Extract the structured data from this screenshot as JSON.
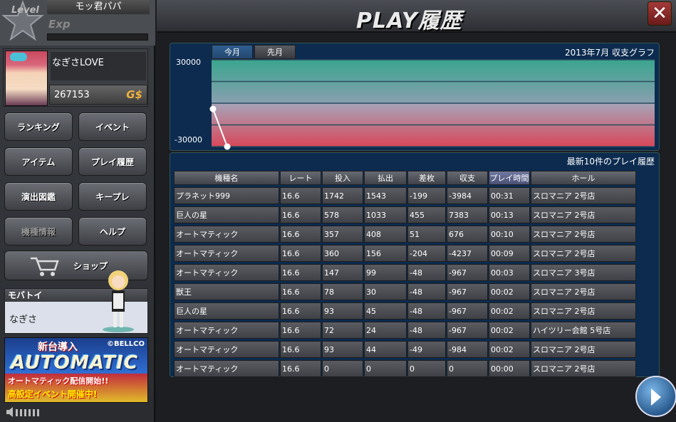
{
  "sidebar": {
    "level_label": "Level",
    "player_name": "モッ君パパ",
    "exp_label": "Exp",
    "profile_name": "なぎさLOVE",
    "coins": "267153",
    "coin_unit": "G$",
    "menu": [
      {
        "label": "ランキング"
      },
      {
        "label": "イベント"
      },
      {
        "label": "アイテム"
      },
      {
        "label": "プレイ履歴"
      },
      {
        "label": "演出図鑑"
      },
      {
        "label": "キープレ"
      },
      {
        "label": "機種情報"
      },
      {
        "label": "ヘルプ"
      }
    ],
    "shop_label": "ショップ",
    "mobatoy_title": "モバトイ",
    "mobatoy_name": "なぎさ",
    "banner": {
      "new": "新台導入",
      "copyright": "©BELLCO",
      "logo": "AUTOMATIC",
      "line2": "オートマティック配信開始!!",
      "line3": "高設定イベント開催中!"
    }
  },
  "header": {
    "title": "PLAY履歴",
    "close": "✕"
  },
  "graph": {
    "tabs": [
      {
        "label": "今月"
      },
      {
        "label": "先月"
      }
    ],
    "title": "2013年7月 収支グラフ"
  },
  "chart_data": {
    "type": "line",
    "title": "2013年7月 収支グラフ",
    "ylim": [
      -30000,
      30000
    ],
    "yticks": [
      "30000",
      "-30000"
    ],
    "x": [
      1,
      2
    ],
    "values": [
      -3984,
      -30000
    ],
    "colors": {
      "positive": "#3aa58e",
      "negative": "#d8485a",
      "line": "#ffffff"
    }
  },
  "history": {
    "title": "最新10件のプレイ履歴",
    "columns": [
      "機種名",
      "レート",
      "投入",
      "払出",
      "差枚",
      "収支",
      "プレイ時間",
      "ホール"
    ],
    "rows": [
      [
        "プラネット999",
        "16.6",
        "1742",
        "1543",
        "-199",
        "-3984",
        "00:31",
        "スロマニア 2号店"
      ],
      [
        "巨人の星",
        "16.6",
        "578",
        "1033",
        "455",
        "7383",
        "00:13",
        "スロマニア 2号店"
      ],
      [
        "オートマティック",
        "16.6",
        "357",
        "408",
        "51",
        "676",
        "00:10",
        "スロマニア 2号店"
      ],
      [
        "オートマティック",
        "16.6",
        "360",
        "156",
        "-204",
        "-4237",
        "00:09",
        "スロマニア 2号店"
      ],
      [
        "オートマティック",
        "16.6",
        "147",
        "99",
        "-48",
        "-967",
        "00:03",
        "スロマニア 3号店"
      ],
      [
        "獣王",
        "16.6",
        "78",
        "30",
        "-48",
        "-967",
        "00:02",
        "スロマニア 2号店"
      ],
      [
        "巨人の星",
        "16.6",
        "93",
        "45",
        "-48",
        "-967",
        "00:02",
        "スロマニア 2号店"
      ],
      [
        "オートマティック",
        "16.6",
        "72",
        "24",
        "-48",
        "-967",
        "00:02",
        "ハイツリー会館 5号店"
      ],
      [
        "オートマティック",
        "16.6",
        "93",
        "44",
        "-49",
        "-984",
        "00:02",
        "スロマニア 2号店"
      ],
      [
        "オートマティック",
        "16.6",
        "0",
        "0",
        "0",
        "0",
        "00:00",
        "スロマニア 2号店"
      ]
    ]
  }
}
